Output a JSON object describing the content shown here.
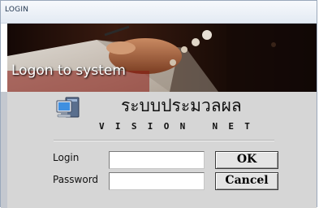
{
  "window": {
    "title": "LOGIN"
  },
  "banner": {
    "text": "Logon to system"
  },
  "header": {
    "app_name_thai": "ระบบประมวลผล",
    "app_name_en": "VISION NET",
    "icon": "computer-icon"
  },
  "form": {
    "login_label": "Login",
    "login_value": "",
    "password_label": "Password",
    "password_value": "",
    "ok_label": "OK",
    "cancel_label": "Cancel"
  },
  "colors": {
    "panel_bg": "#d6d6d6",
    "titlebar_bg": "#e3eaf3",
    "banner_text": "#ffffff"
  }
}
